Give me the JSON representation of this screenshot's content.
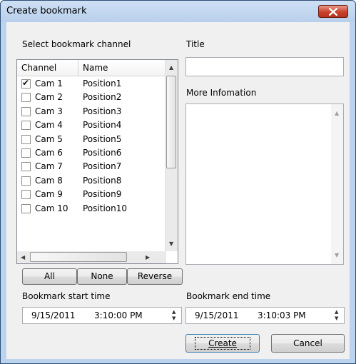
{
  "window": {
    "title": "Create bookmark"
  },
  "select_channel_label": "Select bookmark channel",
  "title_label": "Title",
  "title_value": "",
  "more_info_label": "More Infomation",
  "more_info_value": "",
  "list": {
    "columns": [
      "Channel",
      "Name"
    ],
    "rows": [
      {
        "channel": "Cam 1",
        "name": "Position1",
        "checked": true
      },
      {
        "channel": "Cam 2",
        "name": "Position2",
        "checked": false
      },
      {
        "channel": "Cam 3",
        "name": "Position3",
        "checked": false
      },
      {
        "channel": "Cam 4",
        "name": "Position4",
        "checked": false
      },
      {
        "channel": "Cam 5",
        "name": "Position5",
        "checked": false
      },
      {
        "channel": "Cam 6",
        "name": "Position6",
        "checked": false
      },
      {
        "channel": "Cam 7",
        "name": "Position7",
        "checked": false
      },
      {
        "channel": "Cam 8",
        "name": "Position8",
        "checked": false
      },
      {
        "channel": "Cam 9",
        "name": "Position9",
        "checked": false
      },
      {
        "channel": "Cam 10",
        "name": "Position10",
        "checked": false
      }
    ]
  },
  "buttons": {
    "all": "All",
    "none": "None",
    "reverse": "Reverse",
    "create": "Create",
    "cancel": "Cancel"
  },
  "start_time": {
    "label": "Bookmark start time",
    "date": "9/15/2011",
    "time": "3:10:00 PM"
  },
  "end_time": {
    "label": "Bookmark end time",
    "date": "9/15/2011",
    "time": "3:10:03 PM"
  }
}
